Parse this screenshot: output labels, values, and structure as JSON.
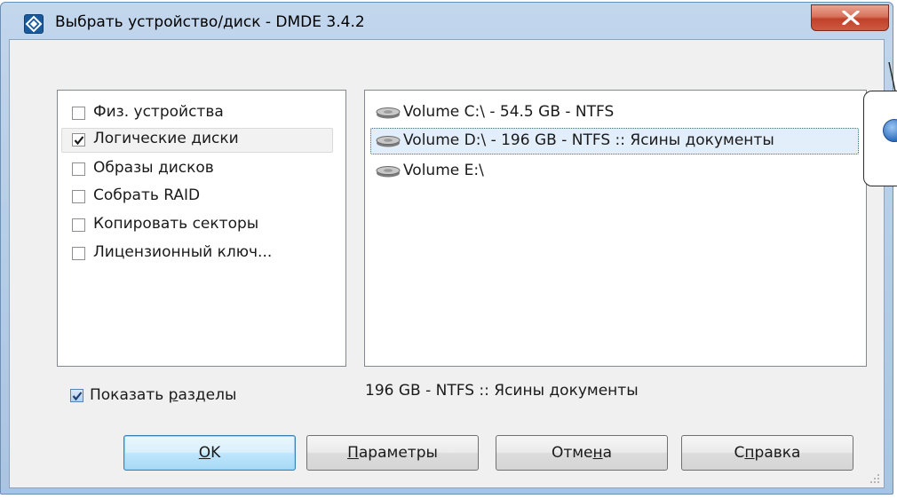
{
  "window": {
    "title": "Выбрать устройство/диск - DMDE 3.4.2",
    "close_icon": "close-x-icon",
    "app_icon": "dmde-logo-icon",
    "accent_color": "#c0412a"
  },
  "options": [
    {
      "label": "Физ. устройства",
      "checked": false
    },
    {
      "label": "Логические диски",
      "checked": true,
      "selected": true
    },
    {
      "label": "Образы дисков",
      "checked": false
    },
    {
      "label": "Собрать RAID",
      "checked": false
    },
    {
      "label": "Копировать секторы",
      "checked": false
    },
    {
      "label": "Лицензионный ключ...",
      "checked": false
    }
  ],
  "volumes": [
    {
      "label": "Volume C:\\ - 54.5 GB - NTFS",
      "icon": "disk-drive-icon"
    },
    {
      "label": "Volume D:\\ - 196 GB - NTFS :: Ясины документы",
      "icon": "disk-drive-icon",
      "selected": true
    },
    {
      "label": "Volume E:\\",
      "icon": "disk-drive-icon"
    }
  ],
  "show_partitions": {
    "label_pre": "Показать ",
    "label_mnemonic": "р",
    "label_post": "азделы",
    "checked": true
  },
  "status": "196 GB - NTFS :: Ясины документы",
  "buttons": {
    "ok": {
      "mnemonic": "O",
      "rest": "K"
    },
    "params": {
      "mnemonic": "П",
      "rest": "араметры"
    },
    "cancel": {
      "pre": "Отме",
      "mnemonic": "н",
      "post": "а"
    },
    "help": {
      "pre": "С",
      "mnemonic": "п",
      "post": "равка"
    }
  }
}
